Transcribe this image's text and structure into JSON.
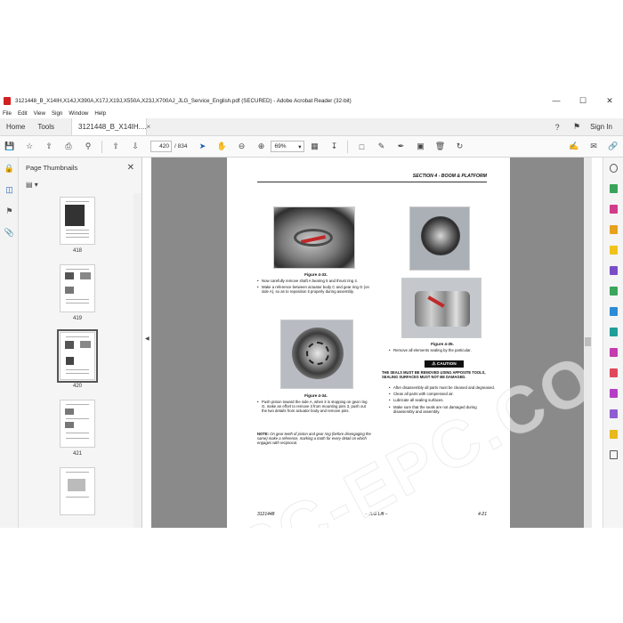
{
  "window": {
    "title": "3121448_B_X14IH,X14J,X390A,X17J,X19J,X550A,X23J,X700AJ_JLG_Service_English.pdf (SECURED) - Adobe Acrobat Reader (32-bit)",
    "minimize": "—",
    "maximize": "☐",
    "close": "✕"
  },
  "menu": [
    "File",
    "Edit",
    "View",
    "Sign",
    "Window",
    "Help"
  ],
  "tabs": {
    "home": "Home",
    "tools": "Tools",
    "document": "3121448_B_X14IH....",
    "close": "×",
    "signin": "Sign In"
  },
  "toolbar": {
    "page_current": "420",
    "page_total": "/ 834",
    "zoom": "69%"
  },
  "thumbnails": {
    "title": "Page Thumbnails",
    "pages": [
      "418",
      "419",
      "420",
      "421"
    ]
  },
  "page": {
    "header": "SECTION 4 - BOOM & PLATFORM",
    "fig33": "Figure 4-33.",
    "fig34": "Figure 4-34.",
    "fig35": "Figure 4-35.",
    "left_bullets_1": [
      "Now carefully remove shaft A bearing 5 and thrust ring 4.",
      "Make a reference between actuator body C and gear ring G (on side A), so as to reposition it properly during assembly."
    ],
    "left_bullets_2": [
      "Push piston toward the side A, when it is stopping on gear ring G, make an effort to remove it from mounting pins 3, push out the two details from actuator body and remove pins."
    ],
    "note_label": "NOTE:",
    "note_text": "On gear teeth of piston and gear ring (before disengaging the same) make a reference, marking a tooth for every detail on which engages with reciprocal.",
    "right_bullet_1": "Remove all elements sealing by the particular.",
    "caution_label": "CAUTION",
    "caution_text": "THE SEALS MUST BE REMOVED USING APPOSITE TOOLS, SEALING SURFACES MUST NOT BE DAMAGED.",
    "right_bullets_2": [
      "After disassembly all parts must be cleaned and degreased.",
      "Clean all parts with compressed air.",
      "Lubricate all sealing surfaces.",
      "Make sure that the seals are not damaged during disassembly and assembly."
    ],
    "footer_left": "3121448",
    "footer_center": "– JLG Lift –",
    "footer_right": "4-21",
    "watermark": "EPC-EPC.COM"
  },
  "colors": {
    "accent": "#1a5fb4",
    "acrobat_red": "#d21f1f",
    "doc_background": "#8a8a8a"
  }
}
